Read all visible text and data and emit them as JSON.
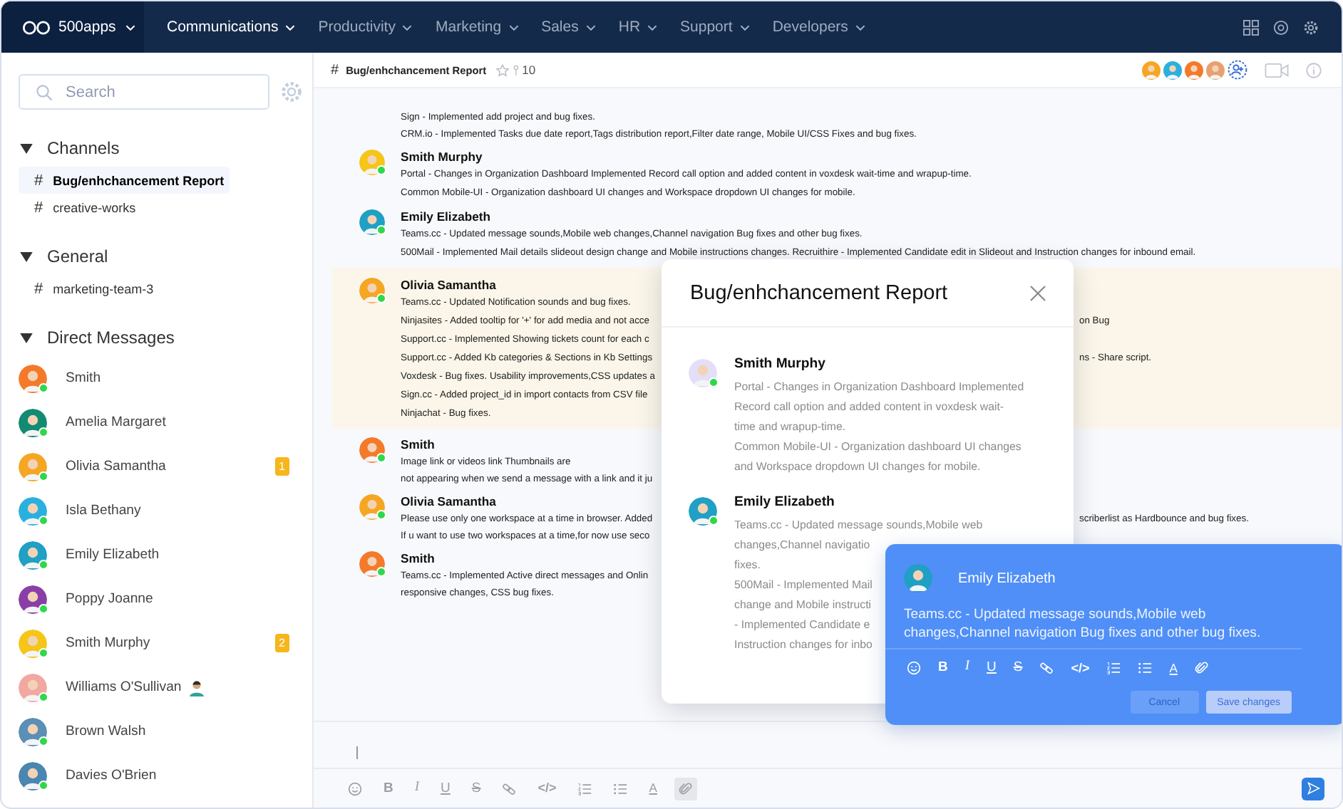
{
  "top_nav": {
    "logo": "500apps",
    "items": [
      {
        "label": "Communications",
        "selected": true
      },
      {
        "label": "Productivity",
        "selected": false
      },
      {
        "label": "Marketing",
        "selected": false
      },
      {
        "label": "Sales",
        "selected": false
      },
      {
        "label": "HR",
        "selected": false
      },
      {
        "label": "Support",
        "selected": false
      },
      {
        "label": "Developers",
        "selected": false
      }
    ]
  },
  "sidebar": {
    "search": {
      "placeholder": "Search"
    },
    "groups": [
      {
        "title": "Channels",
        "expanded": true,
        "items": [
          {
            "hash": "#",
            "label": "Bug/enhchancement Report",
            "selected": true
          },
          {
            "hash": "#",
            "label": "creative-works",
            "selected": false
          }
        ]
      },
      {
        "title": "General",
        "expanded": true,
        "items": [
          {
            "hash": "#",
            "label": "marketing-team-3",
            "selected": false
          }
        ]
      }
    ],
    "direct_messages": {
      "title": "Direct Messages",
      "expanded": true,
      "items": [
        {
          "name": "Smith",
          "color": "#f47a2a",
          "online": true,
          "status_icon": false
        },
        {
          "name": "Amelia Margaret",
          "color": "#138a72",
          "online": true,
          "status_icon": false
        },
        {
          "name": "Olivia Samantha",
          "color": "#f5a623",
          "online": true,
          "status_icon": false,
          "badge": "1"
        },
        {
          "name": "Isla Bethany",
          "color": "#2ab0de",
          "online": true,
          "status_icon": false
        },
        {
          "name": "Emily Elizabeth",
          "color": "#1fa0c4",
          "online": true,
          "status_icon": false
        },
        {
          "name": "Poppy Joanne",
          "color": "#8a3fa8",
          "online": true,
          "status_icon": false
        },
        {
          "name": "Smith Murphy",
          "color": "#f5c518",
          "online": true,
          "status_icon": false,
          "badge": "2"
        },
        {
          "name": "Williams O'Sullivan",
          "color": "#f2a7a0",
          "online": true,
          "status_icon": true
        },
        {
          "name": "Brown Walsh",
          "color": "#5b8fb5",
          "online": true,
          "status_icon": false
        },
        {
          "name": "Davies O'Brien",
          "color": "#4a86b0",
          "online": true,
          "status_icon": false
        }
      ]
    }
  },
  "channel": {
    "hash": "#",
    "title": "Bug/enhchancement Report",
    "starred": false,
    "pin_count": "10",
    "members": [
      {
        "color": "#f5a623"
      },
      {
        "color": "#2ab0de"
      },
      {
        "color": "#f47a2a"
      },
      {
        "color": "#e8a070"
      }
    ]
  },
  "messages": [
    {
      "highlighted": false,
      "lines": [
        {
          "text": "Sign - Implemented add project and bug fixes."
        },
        {
          "text": "CRM.io - Implemented Tasks due date report,Tags distribution report,Filter date range, Mobile UI/CSS Fixes and bug fixes."
        }
      ]
    },
    {
      "author": "Smith Murphy",
      "color": "#f5c518",
      "online": true,
      "highlighted": false,
      "lines": [
        {
          "text": "Portal - Changes in Organization Dashboard Implemented Record call option and added content in voxdesk wait-time and wrapup-time."
        },
        {
          "text": "Common Mobile-UI - Organization dashboard UI changes and Workspace dropdown UI changes for mobile."
        }
      ]
    },
    {
      "author": "Emily Elizabeth",
      "color": "#1fa0c4",
      "online": true,
      "highlighted": false,
      "lines": [
        {
          "text": "Teams.cc - Updated message sounds,Mobile web changes,Channel navigation Bug fixes and other bug fixes."
        },
        {
          "text": "500Mail - Implemented Mail details slideout design change and Mobile instructions changes. Recruithire - Implemented Candidate edit in Slideout and Instruction changes for inbound email."
        }
      ]
    },
    {
      "author": "Olivia Samantha",
      "color": "#f5a623",
      "online": true,
      "highlighted": true,
      "lines": [
        {
          "text": "Teams.cc - Updated Notification sounds and bug fixes."
        },
        {
          "text": "Ninjasites - Added tooltip for '+' for add media and not acce",
          "tail": "on Bug"
        },
        {
          "text": "Support.cc - Implemented Showing tickets count for each c"
        },
        {
          "text": "Support.cc - Added Kb categories & Sections in Kb Settings",
          "tail": "ns - Share script."
        },
        {
          "text": "Voxdesk - Bug fixes. Usability improvements,CSS updates a"
        },
        {
          "text": "Sign.cc - Added project_id in import contacts from CSV file"
        },
        {
          "text": "Ninjachat - Bug fixes."
        }
      ]
    },
    {
      "author": "Smith",
      "color": "#f47a2a",
      "online": true,
      "highlighted": false,
      "lines": [
        {
          "text": "Image link or videos link Thumbnails are"
        },
        {
          "text": "not appearing when we send a message with a link and it ju"
        }
      ]
    },
    {
      "author": "Olivia Samantha",
      "color": "#f5a623",
      "online": true,
      "highlighted": false,
      "lines": [
        {
          "text": "Please use only one workspace at a time in browser. Added",
          "tail": "scriberlist as Hardbounce and bug fixes."
        },
        {
          "text": "If u want to use two workspaces at a time,for now use seco"
        }
      ]
    },
    {
      "author": "Smith",
      "color": "#f47a2a",
      "online": true,
      "highlighted": false,
      "lines": [
        {
          "text": "Teams.cc - Implemented Active direct messages and Onlin"
        },
        {
          "text": "responsive changes, CSS bug fixes."
        }
      ]
    }
  ],
  "modal": {
    "title": "Bug/enhchancement Report",
    "messages": [
      {
        "author": "Smith Murphy",
        "color": "#e4def7",
        "online": true,
        "lines": [
          "Portal - Changes in Organization Dashboard Implemented",
          "Record call option and added content in voxdesk wait-",
          "time and wrapup-time.",
          "Common Mobile-UI - Organization dashboard UI changes",
          "and Workspace dropdown UI changes for mobile."
        ]
      },
      {
        "author": "Emily Elizabeth",
        "color": "#1fa0c4",
        "online": true,
        "lines": [
          "Teams.cc - Updated message sounds,Mobile web",
          "changes,Channel navigatio",
          "fixes.",
          "500Mail - Implemented Mail",
          "change and Mobile instructi",
          "- Implemented Candidate e",
          "Instruction changes for inbo"
        ]
      }
    ]
  },
  "edit_popup": {
    "author": "Emily Elizabeth",
    "color": "#1fa0c4",
    "text": "Teams.cc - Updated message sounds,Mobile web changes,Channel navigation Bug fixes and other bug fixes.",
    "toolbar": [
      {
        "kind": "emoji"
      },
      {
        "kind": "bold",
        "glyph": "B"
      },
      {
        "kind": "italic",
        "glyph": "I"
      },
      {
        "kind": "underline",
        "glyph": "U"
      },
      {
        "kind": "strike",
        "glyph": "S"
      },
      {
        "kind": "link"
      },
      {
        "kind": "code",
        "glyph": "</>"
      },
      {
        "kind": "ordered-list"
      },
      {
        "kind": "bullet-list"
      },
      {
        "kind": "text-color",
        "glyph": "A"
      },
      {
        "kind": "attach"
      }
    ],
    "buttons": [
      {
        "label": "Cancel",
        "kind": "secondary"
      },
      {
        "label": "Save changes",
        "kind": "primary"
      }
    ]
  },
  "composer": {
    "toolbar": [
      {
        "kind": "emoji",
        "selected": false
      },
      {
        "kind": "bold",
        "glyph": "B",
        "selected": false
      },
      {
        "kind": "italic",
        "glyph": "I",
        "selected": false
      },
      {
        "kind": "underline",
        "glyph": "U",
        "selected": false
      },
      {
        "kind": "strike",
        "glyph": "S",
        "selected": false
      },
      {
        "kind": "link",
        "selected": false
      },
      {
        "kind": "code",
        "glyph": "</>",
        "selected": false
      },
      {
        "kind": "ordered-list",
        "selected": false
      },
      {
        "kind": "bullet-list",
        "selected": false
      },
      {
        "kind": "text-color",
        "glyph": "A",
        "selected": false
      },
      {
        "kind": "attach",
        "selected": true
      }
    ]
  }
}
